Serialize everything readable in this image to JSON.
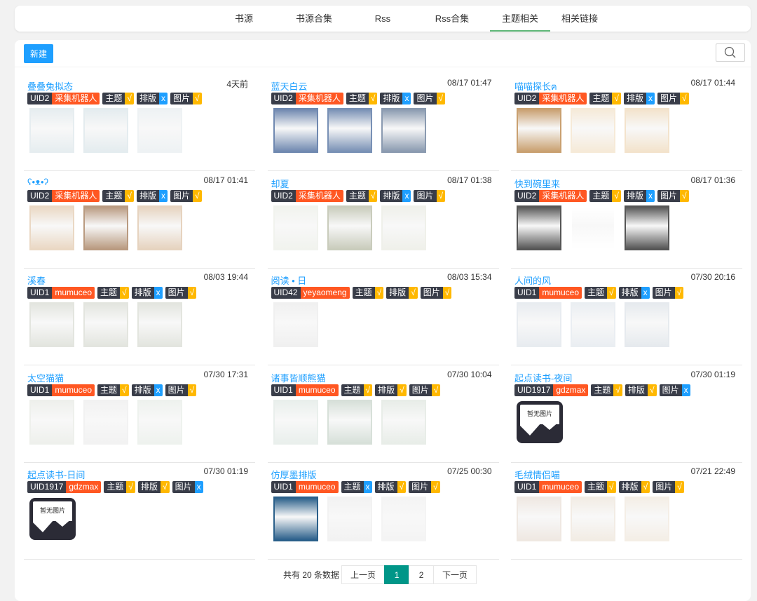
{
  "nav": {
    "tabs": [
      "书源",
      "书源合集",
      "Rss",
      "Rss合集",
      "主题相关",
      "相关链接"
    ],
    "active": 4
  },
  "toolbar": {
    "new_label": "新建",
    "search_icon": "search-icon"
  },
  "colors": {
    "accent": "#1e9fff",
    "tag_dark": "#393d49",
    "author": "#ff5722",
    "yes": "#ffb800",
    "no": "#1e9fff",
    "page_active": "#009688"
  },
  "no_image_label": "暂无图片",
  "cards": [
    {
      "title": "叠叠兔拟态",
      "time": "4天前",
      "uid": "UID2",
      "author": "采集机器人",
      "tags": [
        [
          "主题",
          "√"
        ],
        [
          "排版",
          "x"
        ],
        [
          "图片",
          "√"
        ]
      ],
      "thumbs": [
        "#e6edf0",
        "#e4ecef",
        "#eef2f4"
      ]
    },
    {
      "title": "蓝天白云",
      "time": "08/17 01:47",
      "uid": "UID2",
      "author": "采集机器人",
      "tags": [
        [
          "主题",
          "√"
        ],
        [
          "排版",
          "x"
        ],
        [
          "图片",
          "√"
        ]
      ],
      "thumbs": [
        "#6f88b0",
        "#7890b5",
        "#8a9ab0"
      ]
    },
    {
      "title": "喵喵探长ฅ",
      "time": "08/17 01:44",
      "uid": "UID2",
      "author": "采集机器人",
      "tags": [
        [
          "主题",
          "√"
        ],
        [
          "排版",
          "x"
        ],
        [
          "图片",
          "√"
        ]
      ],
      "thumbs": [
        "#c9a070",
        "#f6ead8",
        "#f3e3cc"
      ]
    },
    {
      "title": "ʕ•ᴥ•ʔ",
      "time": "08/17 01:41",
      "uid": "UID2",
      "author": "采集机器人",
      "tags": [
        [
          "主题",
          "√"
        ],
        [
          "排版",
          "x"
        ],
        [
          "图片",
          "√"
        ]
      ],
      "thumbs": [
        "#ead8c4",
        "#b99a80",
        "#e6d3bf"
      ]
    },
    {
      "title": "却夏",
      "time": "08/17 01:38",
      "uid": "UID2",
      "author": "采集机器人",
      "tags": [
        [
          "主题",
          "√"
        ],
        [
          "排版",
          "x"
        ],
        [
          "图片",
          "√"
        ]
      ],
      "thumbs": [
        "#f1f3ee",
        "#c9ccbc",
        "#eff0ea"
      ]
    },
    {
      "title": "快到碗里来",
      "time": "08/17 01:36",
      "uid": "UID2",
      "author": "采集机器人",
      "tags": [
        [
          "主题",
          "√"
        ],
        [
          "排版",
          "x"
        ],
        [
          "图片",
          "√"
        ]
      ],
      "thumbs": [
        "#555555",
        "#ffffff",
        "#555555"
      ]
    },
    {
      "title": "溪春",
      "time": "08/03 19:44",
      "uid": "UID1",
      "author": "mumuceo",
      "tags": [
        [
          "主题",
          "√"
        ],
        [
          "排版",
          "x"
        ],
        [
          "图片",
          "√"
        ]
      ],
      "thumbs": [
        "#e3e5df",
        "#e3e5df",
        "#e3e5df"
      ]
    },
    {
      "title": "阅读 • 日",
      "time": "08/03 15:34",
      "uid": "UID42",
      "author": "yeyaomeng",
      "tags": [
        [
          "主题",
          "√"
        ],
        [
          "排版",
          "√"
        ],
        [
          "图片",
          "√"
        ]
      ],
      "thumbs": [
        "#f0f0f0"
      ]
    },
    {
      "title": "人间的风",
      "time": "07/30 20:16",
      "uid": "UID1",
      "author": "mumuceo",
      "tags": [
        [
          "主题",
          "√"
        ],
        [
          "排版",
          "x"
        ],
        [
          "图片",
          "√"
        ]
      ],
      "thumbs": [
        "#e8ecf0",
        "#eaeef2",
        "#e6eaee"
      ]
    },
    {
      "title": "太空猫猫",
      "time": "07/30 17:31",
      "uid": "UID1",
      "author": "mumuceo",
      "tags": [
        [
          "主题",
          "√"
        ],
        [
          "排版",
          "x"
        ],
        [
          "图片",
          "√"
        ]
      ],
      "thumbs": [
        "#eef0ec",
        "#f2f2f2",
        "#eef2ee"
      ]
    },
    {
      "title": "诸事皆顺熊猫",
      "time": "07/30 10:04",
      "uid": "UID1",
      "author": "mumuceo",
      "tags": [
        [
          "主题",
          "√"
        ],
        [
          "排版",
          "√"
        ],
        [
          "图片",
          "√"
        ]
      ],
      "thumbs": [
        "#e9efec",
        "#d7e0d9",
        "#e8ede8"
      ]
    },
    {
      "title": "起点读书-夜间",
      "time": "07/30 01:19",
      "uid": "UID1917",
      "author": "gdzmax",
      "tags": [
        [
          "主题",
          "√"
        ],
        [
          "排版",
          "√"
        ],
        [
          "图片",
          "x"
        ]
      ],
      "thumbs": []
    },
    {
      "title": "起点读书-日间",
      "time": "07/30 01:19",
      "uid": "UID1917",
      "author": "gdzmax",
      "tags": [
        [
          "主题",
          "√"
        ],
        [
          "排版",
          "√"
        ],
        [
          "图片",
          "x"
        ]
      ],
      "thumbs": []
    },
    {
      "title": "仿厚墨排版",
      "time": "07/25 00:30",
      "uid": "UID1",
      "author": "mumuceo",
      "tags": [
        [
          "主题",
          "x"
        ],
        [
          "排版",
          "√"
        ],
        [
          "图片",
          "√"
        ]
      ],
      "thumbs": [
        "#2a5f8a",
        "#f2f2f2",
        "#f4f4f4"
      ]
    },
    {
      "title": "毛绒情侣喵",
      "time": "07/21 22:49",
      "uid": "UID1",
      "author": "mumuceo",
      "tags": [
        [
          "主题",
          "√"
        ],
        [
          "排版",
          "√"
        ],
        [
          "图片",
          "√"
        ]
      ],
      "thumbs": [
        "#efe8e2",
        "#f2ece4",
        "#f4eee6"
      ]
    }
  ],
  "pager": {
    "total_label": "共有 20 条数据",
    "prev": "上一页",
    "pages": [
      "1",
      "2"
    ],
    "current": "1",
    "next": "下一页"
  }
}
